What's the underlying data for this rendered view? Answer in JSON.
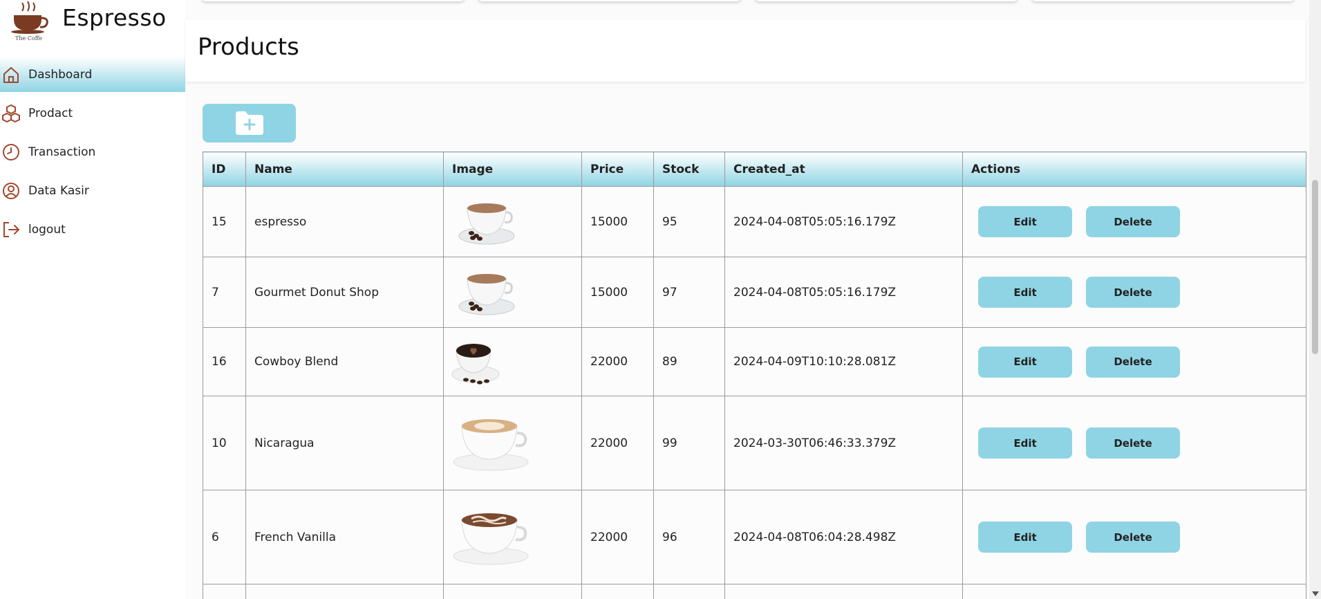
{
  "brand": {
    "name": "Espresso",
    "logo_caption": "The Coffe"
  },
  "sidebar": {
    "items": [
      {
        "label": "Dashboard",
        "icon": "home-icon",
        "active": true
      },
      {
        "label": "Prodact",
        "icon": "cubes-icon",
        "active": false
      },
      {
        "label": "Transaction",
        "icon": "clock-icon",
        "active": false
      },
      {
        "label": "Data Kasir",
        "icon": "user-circle-icon",
        "active": false
      },
      {
        "label": "logout",
        "icon": "logout-icon",
        "active": false
      }
    ]
  },
  "page": {
    "title": "Products",
    "add_button_icon": "folder-plus-icon"
  },
  "table": {
    "columns": [
      "ID",
      "Name",
      "Image",
      "Price",
      "Stock",
      "Created_at",
      "Actions"
    ],
    "rows": [
      {
        "id": "15",
        "name": "espresso",
        "image": "coffee-cup-beans",
        "price": "15000",
        "stock": "95",
        "created_at": "2024-04-08T05:05:16.179Z"
      },
      {
        "id": "7",
        "name": "Gourmet Donut Shop",
        "image": "coffee-cup-beans",
        "price": "15000",
        "stock": "97",
        "created_at": "2024-04-08T05:05:16.179Z"
      },
      {
        "id": "16",
        "name": "Cowboy Blend",
        "image": "black-coffee-heart",
        "price": "22000",
        "stock": "89",
        "created_at": "2024-04-09T10:10:28.081Z"
      },
      {
        "id": "10",
        "name": "Nicaragua",
        "image": "latte-art-cup",
        "price": "22000",
        "stock": "99",
        "created_at": "2024-03-30T06:46:33.379Z"
      },
      {
        "id": "6",
        "name": "French Vanilla",
        "image": "mocha-cup",
        "price": "22000",
        "stock": "96",
        "created_at": "2024-04-08T06:04:28.498Z"
      }
    ],
    "edit_label": "Edit",
    "delete_label": "Delete"
  },
  "colors": {
    "accent": "#8fd4e4",
    "icon": "#a0472b"
  }
}
